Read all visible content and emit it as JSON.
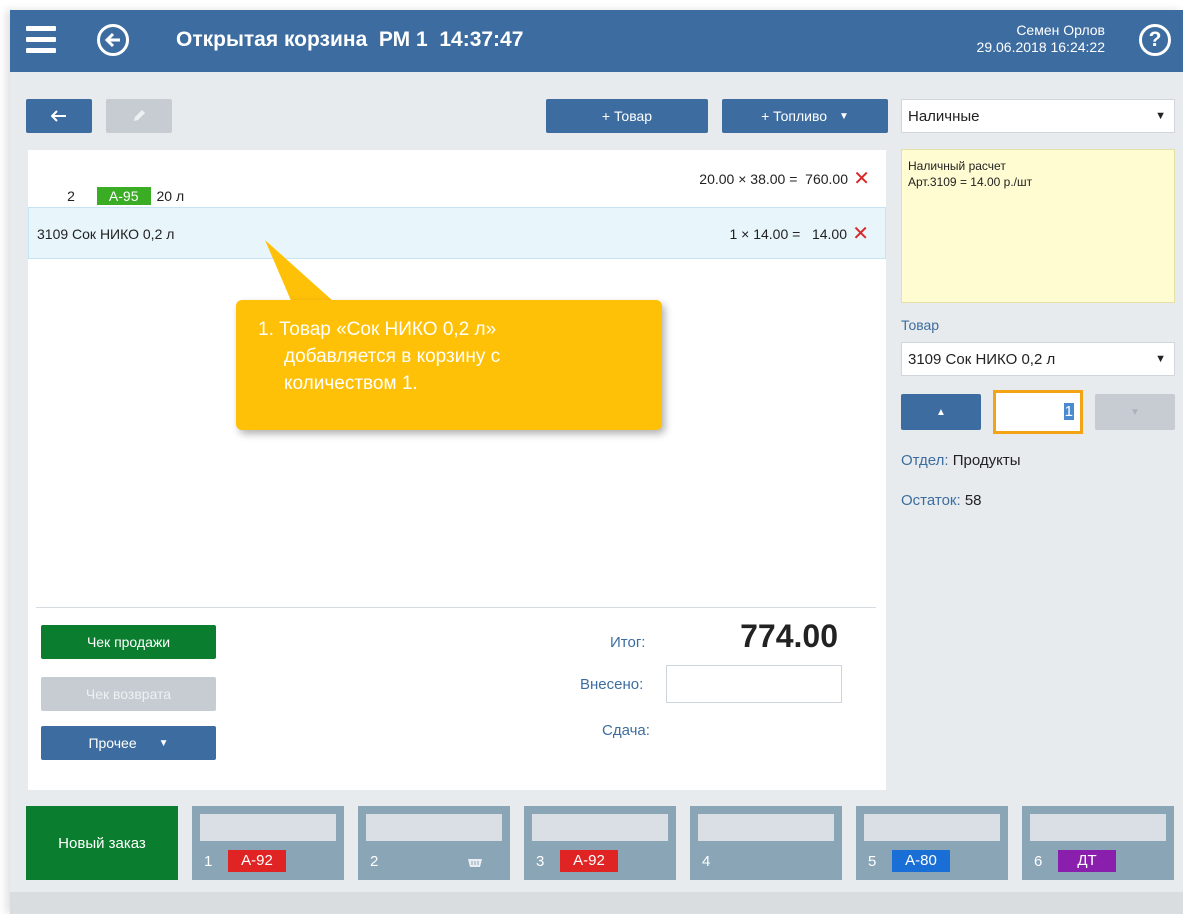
{
  "header": {
    "title": "Открытая корзина  РМ 1  14:37:47",
    "user_name": "Семен Орлов",
    "datetime": "29.06.2018 16:24:22"
  },
  "toolbar": {
    "add_product_label": "+ Товар",
    "add_fuel_label": "+ Топливо"
  },
  "cart": {
    "items": [
      {
        "num": "2",
        "fuel": "А-95",
        "fuel_color": "#3aad24",
        "volume": "20 л",
        "calc": "20.00 × 38.00 =  760.00"
      },
      {
        "name": "3109 Сок НИКО 0,2 л",
        "calc": "1 × 14.00 =   14.00"
      }
    ]
  },
  "callout": {
    "line1": "1. Товар «Сок НИКО 0,2 л»",
    "line2": "добавляется в корзину с",
    "line3": "количеством 1."
  },
  "actions": {
    "sale_receipt": "Чек продажи",
    "return_receipt": "Чек возврата",
    "other": "Прочее"
  },
  "totals": {
    "total_label": "Итог:",
    "total_value": "774.00",
    "paid_label": "Внесено:",
    "paid_value": "",
    "change_label": "Сдача:"
  },
  "right_panel": {
    "payment_method": "Наличные",
    "info_line1": "Наличный расчет",
    "info_line2": "Арт.3109 = 14.00 р./шт",
    "product_label": "Товар",
    "product_value": "3109  Сок НИКО 0,2 л",
    "quantity": "1",
    "department_key": "Отдел:",
    "department_value": "Продукты",
    "stock_key": "Остаток:",
    "stock_value": "58"
  },
  "orders": {
    "new_order": "Новый заказ",
    "tabs": [
      {
        "num": "1",
        "fuel": "А-92",
        "color": "#e02424"
      },
      {
        "num": "2",
        "fuel": "",
        "icon": "basket-icon"
      },
      {
        "num": "3",
        "fuel": "А-92",
        "color": "#e02424"
      },
      {
        "num": "4",
        "fuel": ""
      },
      {
        "num": "5",
        "fuel": "А-80",
        "color": "#1a6fd6"
      },
      {
        "num": "6",
        "fuel": "ДТ",
        "color": "#8a1fae"
      }
    ]
  },
  "colors": {
    "header_blue": "#3d6da0",
    "action_green": "#0a7d2e",
    "delete_red": "#d62828",
    "callout_yellow": "#ffc107"
  }
}
